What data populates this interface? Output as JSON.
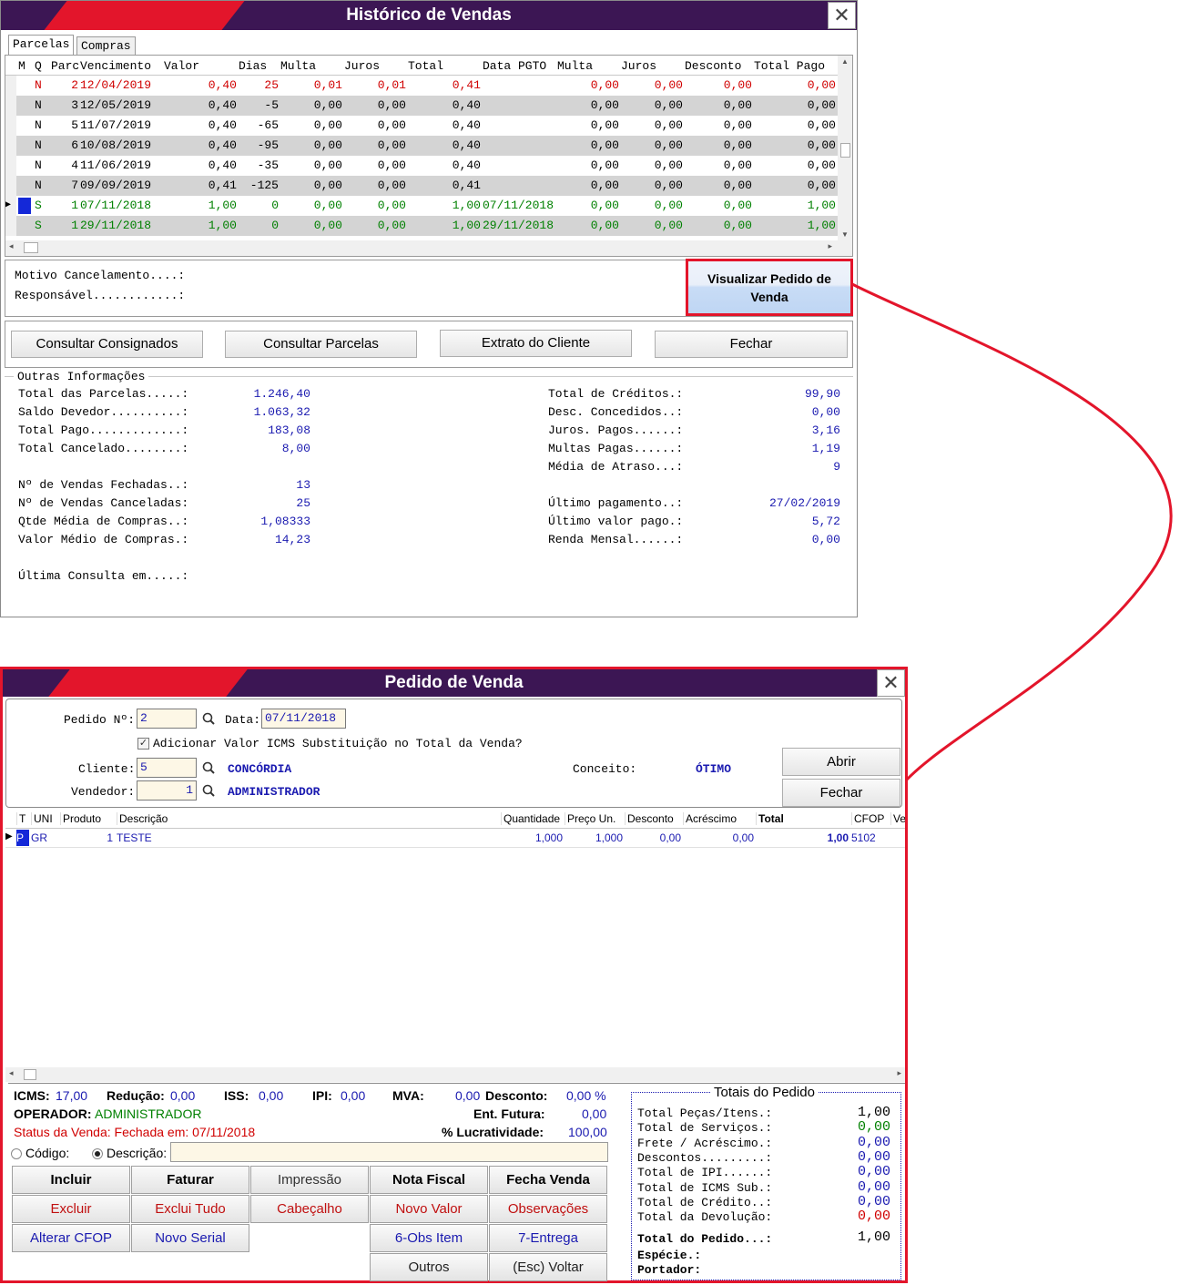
{
  "historico": {
    "title": "Histórico de Vendas",
    "close_glyph": "✕",
    "tabs": [
      "Parcelas",
      "Compras"
    ],
    "columns": [
      "M",
      "Q",
      "Parc",
      "Vencimento",
      "Valor",
      "Dias",
      "Multa",
      "Juros",
      "Total",
      "Data PGTO",
      "Multa",
      "Juros",
      "Desconto",
      "Total Pago"
    ],
    "rows": [
      {
        "q": "N",
        "parc": "2",
        "venc": "12/04/2019",
        "valor": "0,40",
        "dias": "25",
        "multa": "0,01",
        "juros": "0,01",
        "total": "0,41",
        "pgto": "",
        "multa2": "0,00",
        "juros2": "0,00",
        "desc": "0,00",
        "pago": "0,00",
        "color": "#d00000"
      },
      {
        "q": "N",
        "parc": "3",
        "venc": "12/05/2019",
        "valor": "0,40",
        "dias": "-5",
        "multa": "0,00",
        "juros": "0,00",
        "total": "0,40",
        "pgto": "",
        "multa2": "0,00",
        "juros2": "0,00",
        "desc": "0,00",
        "pago": "0,00",
        "color": "#000000"
      },
      {
        "q": "N",
        "parc": "5",
        "venc": "11/07/2019",
        "valor": "0,40",
        "dias": "-65",
        "multa": "0,00",
        "juros": "0,00",
        "total": "0,40",
        "pgto": "",
        "multa2": "0,00",
        "juros2": "0,00",
        "desc": "0,00",
        "pago": "0,00",
        "color": "#000000"
      },
      {
        "q": "N",
        "parc": "6",
        "venc": "10/08/2019",
        "valor": "0,40",
        "dias": "-95",
        "multa": "0,00",
        "juros": "0,00",
        "total": "0,40",
        "pgto": "",
        "multa2": "0,00",
        "juros2": "0,00",
        "desc": "0,00",
        "pago": "0,00",
        "color": "#000000"
      },
      {
        "q": "N",
        "parc": "4",
        "venc": "11/06/2019",
        "valor": "0,40",
        "dias": "-35",
        "multa": "0,00",
        "juros": "0,00",
        "total": "0,40",
        "pgto": "",
        "multa2": "0,00",
        "juros2": "0,00",
        "desc": "0,00",
        "pago": "0,00",
        "color": "#000000"
      },
      {
        "q": "N",
        "parc": "7",
        "venc": "09/09/2019",
        "valor": "0,41",
        "dias": "-125",
        "multa": "0,00",
        "juros": "0,00",
        "total": "0,41",
        "pgto": "",
        "multa2": "0,00",
        "juros2": "0,00",
        "desc": "0,00",
        "pago": "0,00",
        "color": "#000000"
      },
      {
        "q": "S",
        "parc": "1",
        "venc": "07/11/2018",
        "valor": "1,00",
        "dias": "0",
        "multa": "0,00",
        "juros": "0,00",
        "total": "1,00",
        "pgto": "07/11/2018",
        "multa2": "0,00",
        "juros2": "0,00",
        "desc": "0,00",
        "pago": "1,00",
        "color": "#008000"
      },
      {
        "q": "S",
        "parc": "1",
        "venc": "29/11/2018",
        "valor": "1,00",
        "dias": "0",
        "multa": "0,00",
        "juros": "0,00",
        "total": "1,00",
        "pgto": "29/11/2018",
        "multa2": "0,00",
        "juros2": "0,00",
        "desc": "0,00",
        "pago": "1,00",
        "color": "#008000"
      }
    ],
    "motivo_label": "Motivo Cancelamento....:",
    "responsavel_label": "Responsável............:",
    "visualizar_button": "Visualizar Pedido de Venda",
    "buttons": [
      "Consultar Consignados",
      "Consultar Parcelas",
      "Extrato do Cliente",
      "Fechar"
    ],
    "outras_title": "Outras Informações",
    "left_info": [
      {
        "label": "Total das Parcelas.....:",
        "value": "1.246,40"
      },
      {
        "label": "Saldo Devedor..........:",
        "value": "1.063,32"
      },
      {
        "label": "Total Pago.............:",
        "value": "183,08"
      },
      {
        "label": "Total Cancelado........:",
        "value": "8,00"
      },
      {
        "label": "",
        "value": ""
      },
      {
        "label": "Nº de Vendas Fechadas..:",
        "value": "13"
      },
      {
        "label": "Nº de Vendas Canceladas:",
        "value": "25"
      },
      {
        "label": "Qtde Média de Compras..:",
        "value": "1,08333"
      },
      {
        "label": "Valor Médio de Compras.:",
        "value": "14,23"
      },
      {
        "label": "",
        "value": ""
      },
      {
        "label": "Última Consulta em.....:",
        "value": ""
      }
    ],
    "right_info": [
      {
        "label": "Total de Créditos.:",
        "value": "99,90"
      },
      {
        "label": "Desc. Concedidos..:",
        "value": "0,00"
      },
      {
        "label": "Juros. Pagos......:",
        "value": "3,16"
      },
      {
        "label": "Multas Pagas......:",
        "value": "1,19"
      },
      {
        "label": "Média de Atraso...:",
        "value": "9"
      },
      {
        "label": "",
        "value": ""
      },
      {
        "label": "Último pagamento..:",
        "value": "27/02/2019"
      },
      {
        "label": "Último valor pago.:",
        "value": "5,72"
      },
      {
        "label": "Renda Mensal......:",
        "value": "0,00"
      }
    ]
  },
  "pedido": {
    "title": "Pedido de Venda",
    "close_glyph": "✕",
    "pedido_label": "Pedido Nº:",
    "pedido_value": "2",
    "data_label": "Data:",
    "data_value": "07/11/2018",
    "icms_check_label": "Adicionar Valor ICMS Substituição no Total da Venda?",
    "cliente_label": "Cliente:",
    "cliente_value": "5",
    "cliente_name": "CONCÓRDIA",
    "vendedor_label": "Vendedor:",
    "vendedor_value": "1",
    "vendedor_name": "ADMINISTRADOR",
    "conceito_label": "Conceito:",
    "conceito_value": "ÓTIMO",
    "abrir_button": "Abrir",
    "fechar_button": "Fechar",
    "columns": [
      "T",
      "UNI",
      "Produto",
      "Descrição",
      "Quantidade",
      "Preço Un.",
      "Desconto",
      "Acréscimo",
      "Total",
      "CFOP",
      "Ve"
    ],
    "items": [
      {
        "t": "P",
        "uni": "GR",
        "produto": "1",
        "descricao": "TESTE",
        "quantidade": "1,000",
        "preco": "1,000",
        "desconto": "0,00",
        "acrescimo": "0,00",
        "total": "1,00",
        "cfop": "5102"
      }
    ],
    "icms_label": "ICMS:",
    "icms_value": "17,00",
    "reducao_label": "Redução:",
    "reducao_value": "0,00",
    "iss_label": "ISS:",
    "iss_value": "0,00",
    "ipi_label": "IPI:",
    "ipi_value": "0,00",
    "mva_label": "MVA:",
    "mva_value": "0,00",
    "desconto_label": "Desconto:",
    "desconto_value": "0,00 %",
    "operador_label": "OPERADOR:",
    "operador_value": "ADMINISTRADOR",
    "entfutura_label": "Ent. Futura:",
    "entfutura_value": "0,00",
    "status_text": "Status da Venda: Fechada em: 07/11/2018",
    "lucr_label": "% Lucratividade:",
    "lucr_value": "100,00",
    "codigo_label": "Código:",
    "descricao_label": "Descrição:",
    "buttons_row1": [
      "Incluir",
      "Faturar",
      "Impressão",
      "Nota Fiscal",
      "Fecha Venda"
    ],
    "buttons_row2": [
      "Excluir",
      "Exclui Tudo",
      "Cabeçalho",
      "Novo Valor",
      "Observações"
    ],
    "buttons_row3": [
      "Alterar CFOP",
      "Novo Serial",
      "6-Obs Item",
      "7-Entrega"
    ],
    "buttons_row4": [
      "Outros",
      "(Esc) Voltar"
    ],
    "totais_title": "Totais do Pedido",
    "totais": [
      {
        "label": "Total Peças/Itens.:",
        "value": "1,00",
        "color": "#000000"
      },
      {
        "label": "Total de Serviços.:",
        "value": "0,00",
        "color": "#008000"
      },
      {
        "label": "Frete / Acréscimo.:",
        "value": "0,00",
        "color": "#1a1ab0"
      },
      {
        "label": "Descontos.........:",
        "value": "0,00",
        "color": "#1a1ab0"
      },
      {
        "label": "Total de IPI......:",
        "value": "0,00",
        "color": "#1a1ab0"
      },
      {
        "label": "Total de ICMS Sub.:",
        "value": "0,00",
        "color": "#1a1ab0"
      },
      {
        "label": "Total de Crédito..:",
        "value": "0,00",
        "color": "#1a1ab0"
      },
      {
        "label": "Total da Devolução:",
        "value": "0,00",
        "color": "#d00000"
      }
    ],
    "total_pedido_label": "Total do Pedido...:",
    "total_pedido_value": "1,00",
    "especie_label": "Espécie.:",
    "portador_label": "Portador:"
  }
}
